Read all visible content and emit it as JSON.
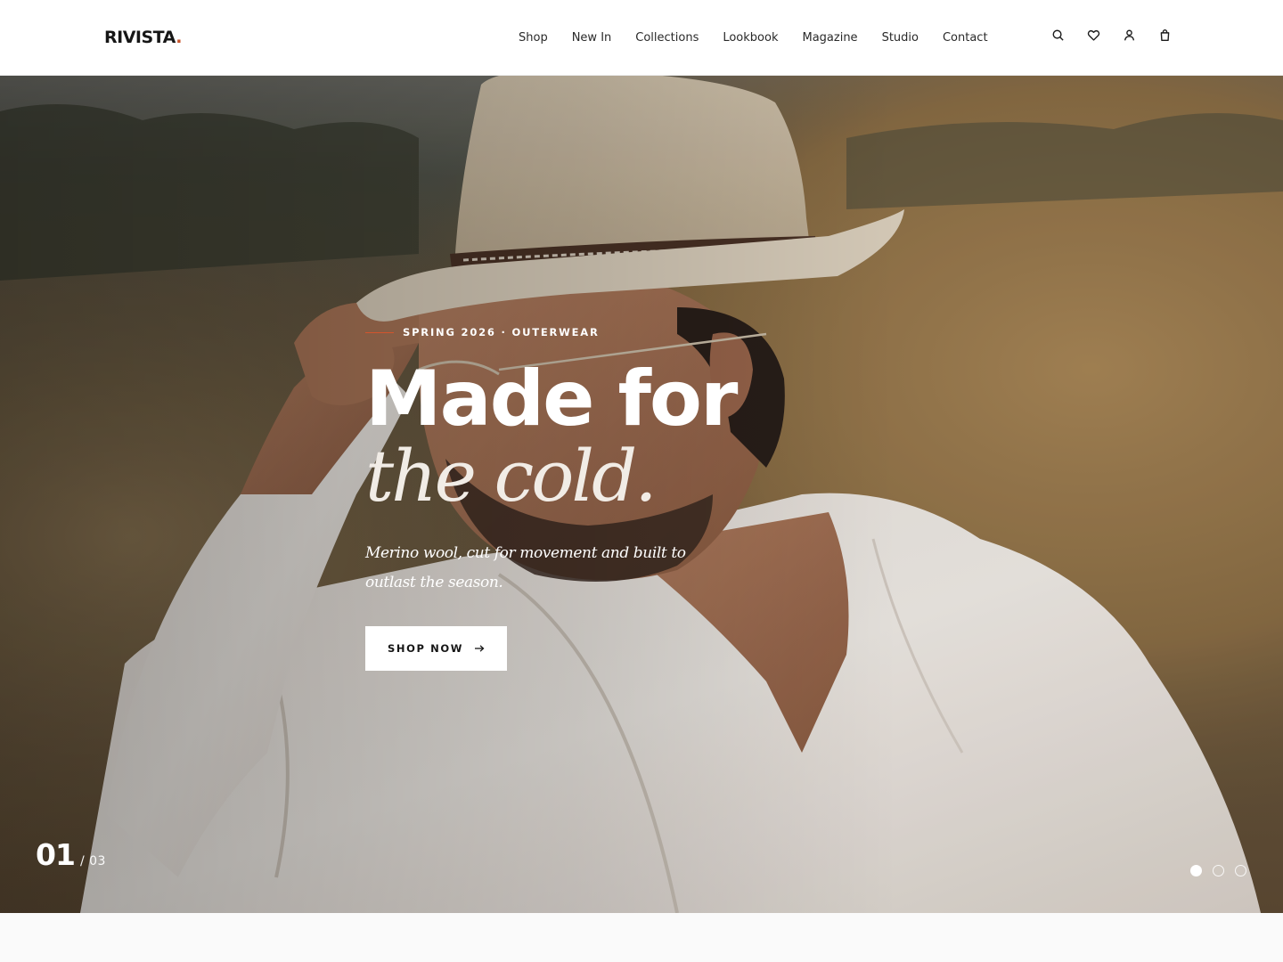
{
  "header": {
    "logo_text": "RIVISTA",
    "logo_dot": ".",
    "nav": [
      "Shop",
      "New In",
      "Collections",
      "Lookbook",
      "Magazine",
      "Studio",
      "Contact"
    ],
    "icons": [
      "search-icon",
      "heart-icon",
      "user-icon",
      "bag-icon"
    ]
  },
  "hero": {
    "eyebrow": "SPRING 2026 · OUTERWEAR",
    "headline": "Made for",
    "headline_italic": "the cold.",
    "subcopy": "Merino wool, cut for movement and built to outlast the season.",
    "cta_label": "SHOP NOW",
    "cta_icon": "arrow-right-icon",
    "counter_current": "01",
    "counter_total": "/ 03",
    "slides": 3,
    "active_slide": 1
  },
  "colors": {
    "accent": "#c9532b",
    "text_dark": "#161616",
    "white": "#ffffff"
  }
}
